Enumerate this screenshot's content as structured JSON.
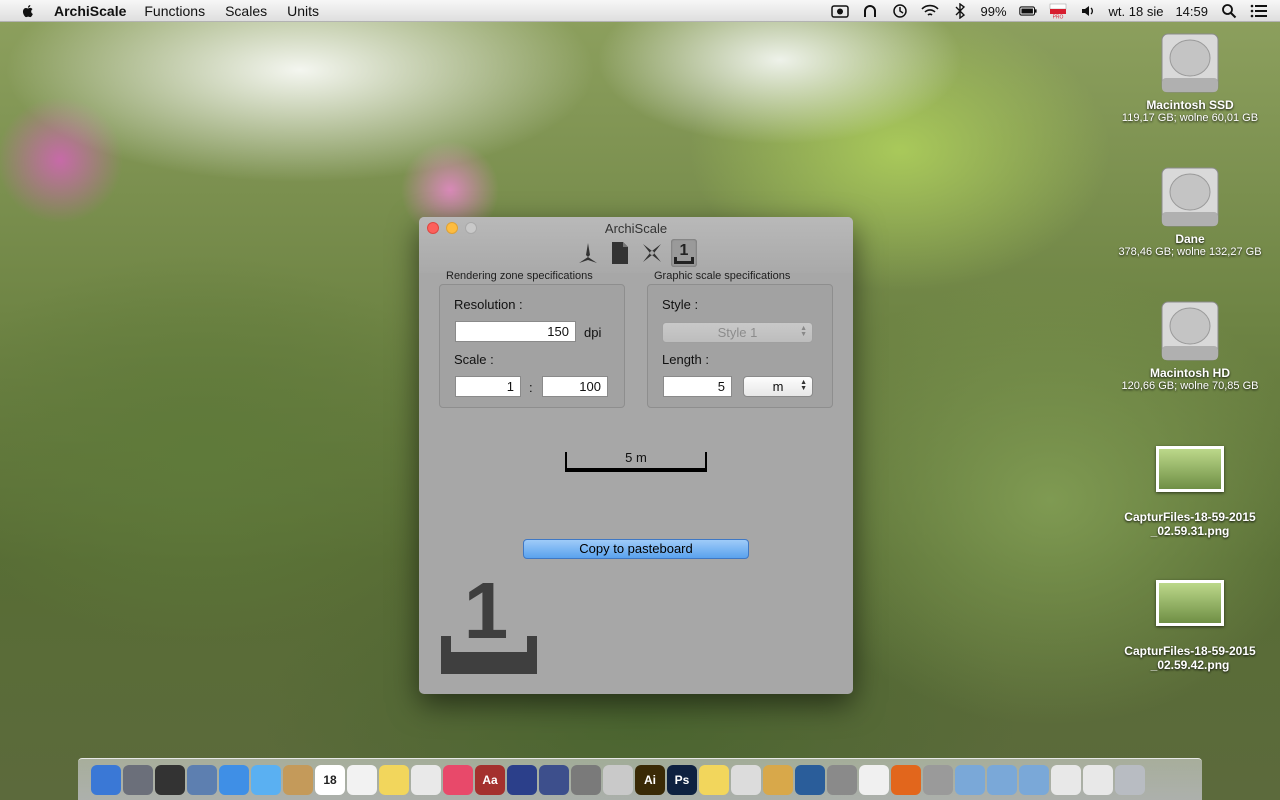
{
  "menubar": {
    "app_name": "ArchiScale",
    "items": [
      "Functions",
      "Scales",
      "Units"
    ],
    "battery": "99%",
    "clock_day": "wt. 18 sie",
    "clock_time": "14:59"
  },
  "desktop": {
    "drives": [
      {
        "name": "Macintosh SSD",
        "info": "119,17 GB; wolne 60,01 GB"
      },
      {
        "name": "Dane",
        "info": "378,46 GB; wolne 132,27 GB"
      },
      {
        "name": "Macintosh HD",
        "info": "120,66 GB; wolne 70,85 GB"
      }
    ],
    "files": [
      {
        "name1": "CapturFiles-18-59-2015",
        "name2": "_02.59.31.png"
      },
      {
        "name1": "CapturFiles-18-59-2015",
        "name2": "_02.59.42.png"
      }
    ]
  },
  "window": {
    "title": "ArchiScale",
    "rendering": {
      "group_label": "Rendering zone specifications",
      "resolution_label": "Resolution :",
      "resolution_value": "150",
      "resolution_unit": "dpi",
      "scale_label": "Scale :",
      "scale_left": "1",
      "scale_sep": ":",
      "scale_right": "100"
    },
    "graphic": {
      "group_label": "Graphic scale specifications",
      "style_label": "Style :",
      "style_value": "Style 1",
      "length_label": "Length :",
      "length_value": "5",
      "length_unit": "m"
    },
    "scalebar_label": "5 m",
    "copy_button": "Copy to pasteboard",
    "logo_digit": "1"
  },
  "dock": {
    "apps": [
      {
        "name": "finder",
        "color": "#3a78d6",
        "label": ""
      },
      {
        "name": "launchpad",
        "color": "#6b6f7a",
        "label": ""
      },
      {
        "name": "dashboard",
        "color": "#333333",
        "label": ""
      },
      {
        "name": "preview",
        "color": "#5d7fb0",
        "label": ""
      },
      {
        "name": "safari",
        "color": "#3f8fe6",
        "label": ""
      },
      {
        "name": "messages",
        "color": "#5ab0f2",
        "label": ""
      },
      {
        "name": "contacts",
        "color": "#c49a5a",
        "label": ""
      },
      {
        "name": "calendar",
        "color": "#ffffff",
        "label": "18"
      },
      {
        "name": "reminders",
        "color": "#f2f2f2",
        "label": ""
      },
      {
        "name": "notes",
        "color": "#f2d65c",
        "label": ""
      },
      {
        "name": "photos",
        "color": "#e9e9e9",
        "label": ""
      },
      {
        "name": "itunes",
        "color": "#e8496a",
        "label": ""
      },
      {
        "name": "dictionary",
        "color": "#a4312e",
        "label": "Aa"
      },
      {
        "name": "uk-flag",
        "color": "#2b3f8a",
        "label": ""
      },
      {
        "name": "ink",
        "color": "#3d4f8c",
        "label": ""
      },
      {
        "name": "utility",
        "color": "#7a7a7a",
        "label": ""
      },
      {
        "name": "calculator",
        "color": "#c9c9c9",
        "label": ""
      },
      {
        "name": "illustrator",
        "color": "#3a2a06",
        "label": "Ai"
      },
      {
        "name": "photoshop",
        "color": "#0e2140",
        "label": "Ps"
      },
      {
        "name": "stickies",
        "color": "#f2d65c",
        "label": ""
      },
      {
        "name": "script",
        "color": "#dcdcdc",
        "label": ""
      },
      {
        "name": "magnifier",
        "color": "#d8a84a",
        "label": ""
      },
      {
        "name": "disc",
        "color": "#2a5d9a",
        "label": ""
      },
      {
        "name": "system-prefs",
        "color": "#8a8a8a",
        "label": ""
      },
      {
        "name": "vivaldi",
        "color": "#f0f0f0",
        "label": ""
      },
      {
        "name": "firefox",
        "color": "#e2661c",
        "label": ""
      },
      {
        "name": "archiscale",
        "color": "#9a9a9a",
        "label": ""
      },
      {
        "name": "applications-folder",
        "color": "#7aa8d8",
        "label": ""
      },
      {
        "name": "documents-folder",
        "color": "#7aa8d8",
        "label": ""
      },
      {
        "name": "downloads-folder",
        "color": "#7aa8d8",
        "label": ""
      },
      {
        "name": "screenshot-1",
        "color": "#e8e8e8",
        "label": ""
      },
      {
        "name": "screenshot-2",
        "color": "#e8e8e8",
        "label": ""
      },
      {
        "name": "trash",
        "color": "#b8bcc2",
        "label": ""
      }
    ]
  }
}
